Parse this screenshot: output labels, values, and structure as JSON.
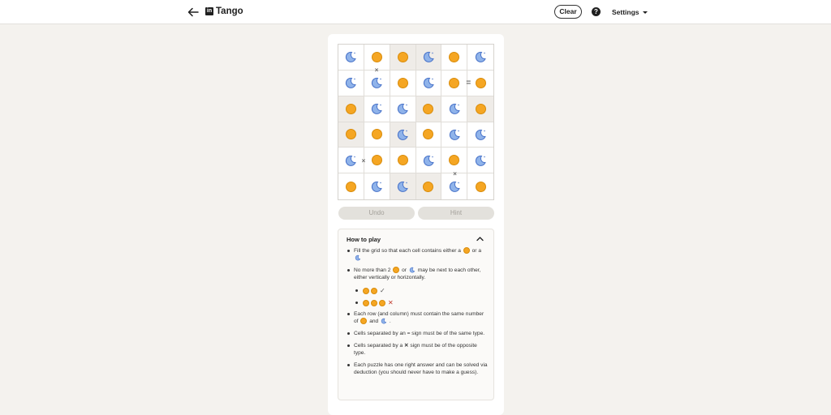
{
  "header": {
    "title": "Tango",
    "logo_text": "in",
    "clear_label": "Clear",
    "help_label": "?",
    "settings_label": "Settings"
  },
  "board": {
    "rows": [
      [
        "moon",
        "sun",
        "sun",
        "moon",
        "sun",
        "moon"
      ],
      [
        "moon",
        "moon",
        "sun",
        "moon",
        "sun",
        "sun"
      ],
      [
        "sun",
        "moon",
        "moon",
        "sun",
        "moon",
        "sun"
      ],
      [
        "sun",
        "sun",
        "moon",
        "sun",
        "moon",
        "moon"
      ],
      [
        "moon",
        "sun",
        "sun",
        "moon",
        "sun",
        "moon"
      ],
      [
        "sun",
        "moon",
        "moon",
        "sun",
        "moon",
        "sun"
      ]
    ],
    "locked": [
      [
        false,
        false,
        true,
        true,
        false,
        false
      ],
      [
        false,
        false,
        false,
        false,
        false,
        false
      ],
      [
        true,
        false,
        false,
        true,
        false,
        true
      ],
      [
        true,
        false,
        true,
        false,
        false,
        false
      ],
      [
        false,
        false,
        false,
        false,
        false,
        false
      ],
      [
        false,
        false,
        true,
        true,
        false,
        false
      ]
    ],
    "constraints": [
      {
        "symbol": "×",
        "between": [
          [
            0,
            1
          ],
          [
            1,
            1
          ]
        ]
      },
      {
        "symbol": "=",
        "between": [
          [
            1,
            4
          ],
          [
            1,
            5
          ]
        ]
      },
      {
        "symbol": "×",
        "between": [
          [
            4,
            0
          ],
          [
            4,
            1
          ]
        ]
      },
      {
        "symbol": "×",
        "between": [
          [
            4,
            4
          ],
          [
            5,
            4
          ]
        ]
      }
    ]
  },
  "controls": {
    "undo_label": "Undo",
    "hint_label": "Hint"
  },
  "how_to_play": {
    "title": "How to play",
    "rule1_a": "Fill the grid so that each cell contains either a",
    "rule1_b": "or a",
    "rule2_a": "No more than 2",
    "rule2_b": "or",
    "rule2_c": "may be next to each other, either vertically or horizontally.",
    "example_ok": "✓",
    "example_bad": "✕",
    "rule3_a": "Each row (and column) must contain the same number of",
    "rule3_b": "and",
    "rule3_c": ".",
    "rule4": "Cells separated by an = sign must be of the same type.",
    "rule5_a": "Cells separated by a",
    "rule5_x": "✕",
    "rule5_b": "sign must be of the opposite type.",
    "rule6": "Each puzzle has one right answer and can be solved via deduction (you should never have to make a guess)."
  },
  "colors": {
    "sun_fill": "#f5a623",
    "moon_fill": "#8fb3ea",
    "moon_stroke": "#4a74c9",
    "background": "#f4f2ee"
  }
}
